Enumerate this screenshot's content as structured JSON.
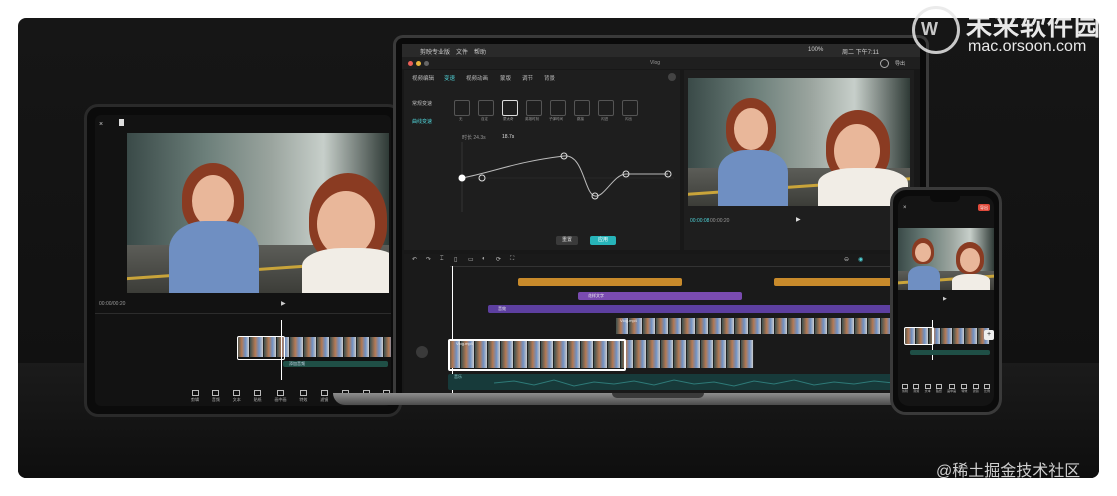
{
  "watermark_top": {
    "brand": "未来软件园",
    "url": "mac.orsoon.com"
  },
  "watermark_bottom": "@稀土掘金技术社区",
  "mac": {
    "menubar": {
      "app": "剪映专业版",
      "file": "文件",
      "help": "帮助",
      "battery": "100%",
      "clock": "周二 下午7:11"
    },
    "window_title": "Vlog",
    "export_label": "导出",
    "panel_tabs": [
      "视频编辑",
      "变速",
      "视频动画",
      "蒙版",
      "调节",
      "背景"
    ],
    "speed_modes": [
      "常规变速",
      "曲线变速"
    ],
    "presets": [
      "无",
      "自定",
      "蒙太奇",
      "英雄时刻",
      "子弹时间",
      "跳接",
      "闪进",
      "闪出"
    ],
    "duration_label": "时长 24.3s",
    "duration_value": "18.7s",
    "reset_label": "重置",
    "apply_label": "应用",
    "player_time": "00:00:08",
    "player_total": "00:00:20",
    "ratio_label": "原始",
    "track_labels": {
      "text_track": "花样文字",
      "effect_track": "音效",
      "video_clip": "Vlog.mp4",
      "sub_clip": "Vlog.mp4",
      "audio": "音乐"
    }
  },
  "tablet": {
    "time": "00:00/00:20",
    "track_label": "添加音频",
    "toolbar": [
      "剪辑",
      "音频",
      "文本",
      "贴纸",
      "画中画",
      "特效",
      "滤镜",
      "比例",
      "背景",
      "调节"
    ]
  },
  "phone": {
    "export_label": "导出",
    "toolbar": [
      "剪辑",
      "音频",
      "文本",
      "贴纸",
      "画中画",
      "特效",
      "滤镜",
      "比例"
    ]
  }
}
